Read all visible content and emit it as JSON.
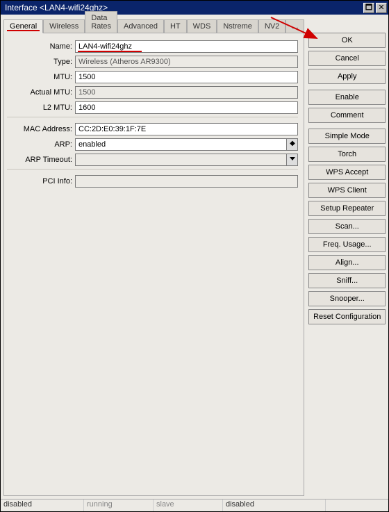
{
  "window": {
    "title": "Interface <LAN4-wifi24ghz>"
  },
  "tabs": [
    {
      "label": "General",
      "active": true,
      "highlighted": true
    },
    {
      "label": "Wireless",
      "active": false,
      "highlighted": false
    },
    {
      "label": "Data Rates",
      "active": false,
      "highlighted": false
    },
    {
      "label": "Advanced",
      "active": false,
      "highlighted": false
    },
    {
      "label": "HT",
      "active": false,
      "highlighted": false
    },
    {
      "label": "WDS",
      "active": false,
      "highlighted": false
    },
    {
      "label": "Nstreme",
      "active": false,
      "highlighted": false
    },
    {
      "label": "NV2",
      "active": false,
      "highlighted": false
    },
    {
      "label": "...",
      "active": false,
      "highlighted": false
    }
  ],
  "fields": {
    "name": {
      "label": "Name:",
      "value": "LAN4-wifi24ghz",
      "underlined": true
    },
    "type": {
      "label": "Type:",
      "value": "Wireless (Atheros AR9300)"
    },
    "mtu": {
      "label": "MTU:",
      "value": "1500"
    },
    "actual_mtu": {
      "label": "Actual MTU:",
      "value": "1500"
    },
    "l2_mtu": {
      "label": "L2 MTU:",
      "value": "1600"
    },
    "mac": {
      "label": "MAC Address:",
      "value": "CC:2D:E0:39:1F:7E"
    },
    "arp": {
      "label": "ARP:",
      "value": "enabled"
    },
    "arp_timeout": {
      "label": "ARP Timeout:",
      "value": ""
    },
    "pci_info": {
      "label": "PCI Info:",
      "value": ""
    }
  },
  "buttons": {
    "ok": "OK",
    "cancel": "Cancel",
    "apply": "Apply",
    "enable": "Enable",
    "comment": "Comment",
    "simple_mode": "Simple Mode",
    "torch": "Torch",
    "wps_accept": "WPS Accept",
    "wps_client": "WPS Client",
    "setup_repeater": "Setup Repeater",
    "scan": "Scan...",
    "freq_usage": "Freq. Usage...",
    "align": "Align...",
    "sniff": "Sniff...",
    "snooper": "Snooper...",
    "reset_config": "Reset Configuration"
  },
  "status": {
    "s1": "disabled",
    "s2": "running",
    "s3": "slave",
    "s4": "disabled"
  }
}
